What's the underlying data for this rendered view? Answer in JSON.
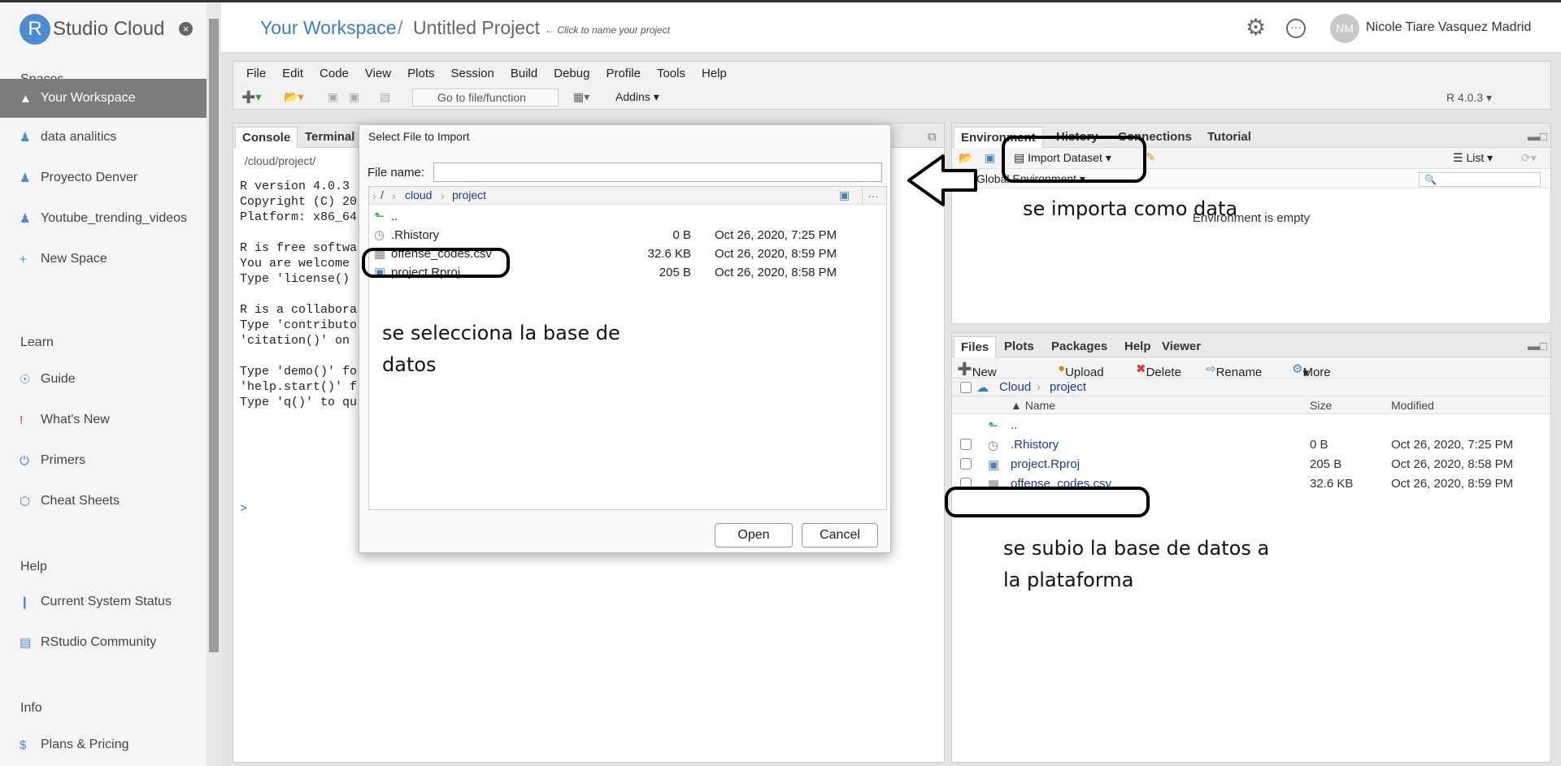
{
  "sidebar": {
    "brand_letter": "R",
    "brand_name": "Studio Cloud",
    "close": "×",
    "spaces_title": "Spaces",
    "spaces": [
      {
        "label": "Your Workspace",
        "active": true
      },
      {
        "label": "data analitics"
      },
      {
        "label": "Proyecto Denver"
      },
      {
        "label": "Youtube_trending_videos"
      }
    ],
    "new_space": "New Space",
    "learn_title": "Learn",
    "learn": [
      "Guide",
      "What's New",
      "Primers",
      "Cheat Sheets"
    ],
    "help_title": "Help",
    "help": [
      "Current System Status",
      "RStudio Community"
    ],
    "info_title": "Info",
    "info": [
      "Plans & Pricing"
    ]
  },
  "header": {
    "workspace": "Your Workspace",
    "separator": "/",
    "project": "Untitled Project",
    "hint": "← Click to name your project",
    "avatar_initials": "NM",
    "user": "Nicole Tiare Vasquez Madrid"
  },
  "ide": {
    "menu": [
      "File",
      "Edit",
      "Code",
      "View",
      "Plots",
      "Session",
      "Build",
      "Debug",
      "Profile",
      "Tools",
      "Help"
    ],
    "goto_placeholder": "Go to file/function",
    "addins": "Addins",
    "r_version": "R 4.0.3"
  },
  "console": {
    "tabs": [
      "Console",
      "Terminal"
    ],
    "path": "/cloud/project/",
    "lines": [
      "R version 4.0.3",
      "Copyright (C) 20",
      "Platform: x86_64",
      "",
      "R is free softwa",
      "You are welcome",
      "Type 'license()",
      "",
      "R is a collabora",
      "Type 'contributo",
      "'citation()' on",
      "",
      "Type 'demo()' fo",
      "'help.start()' f",
      "Type 'q()' to qu"
    ],
    "prompt": ">"
  },
  "environment": {
    "tabs": [
      "Environment",
      "History",
      "Connections",
      "Tutorial"
    ],
    "import_label": "Import Dataset",
    "list_label": "List",
    "scope": "Global Environment",
    "empty_text": "Environment is empty"
  },
  "files": {
    "tabs": [
      "Files",
      "Plots",
      "Packages",
      "Help",
      "Viewer"
    ],
    "toolbar": [
      "New Folder",
      "Upload",
      "Delete",
      "Rename",
      "More"
    ],
    "path": [
      "Cloud",
      "project"
    ],
    "columns": [
      "Name",
      "Size",
      "Modified"
    ],
    "rows": [
      {
        "name": "..",
        "size": "",
        "modified": ""
      },
      {
        "name": ".Rhistory",
        "size": "0 B",
        "modified": "Oct 26, 2020, 7:25 PM"
      },
      {
        "name": "project.Rproj",
        "size": "205 B",
        "modified": "Oct 26, 2020, 8:58 PM"
      },
      {
        "name": "offense_codes.csv",
        "size": "32.6 KB",
        "modified": "Oct 26, 2020, 8:59 PM"
      }
    ]
  },
  "dialog": {
    "title": "Select File to Import",
    "file_name_label": "File name:",
    "path": [
      "/",
      "cloud",
      "project"
    ],
    "rows": [
      {
        "name": "..",
        "size": "",
        "modified": ""
      },
      {
        "name": ".Rhistory",
        "size": "0 B",
        "modified": "Oct 26, 2020, 7:25 PM"
      },
      {
        "name": "offense_codes.csv",
        "size": "32.6 KB",
        "modified": "Oct 26, 2020, 8:59 PM"
      },
      {
        "name": "project.Rproj",
        "size": "205 B",
        "modified": "Oct 26, 2020, 8:58 PM"
      }
    ],
    "open": "Open",
    "cancel": "Cancel"
  },
  "annotations": {
    "import_note": "se importa como data",
    "select_note_1": "se selecciona la base de",
    "select_note_2": "datos",
    "upload_note_1": "se subio la base de datos a",
    "upload_note_2": "la plataforma"
  }
}
